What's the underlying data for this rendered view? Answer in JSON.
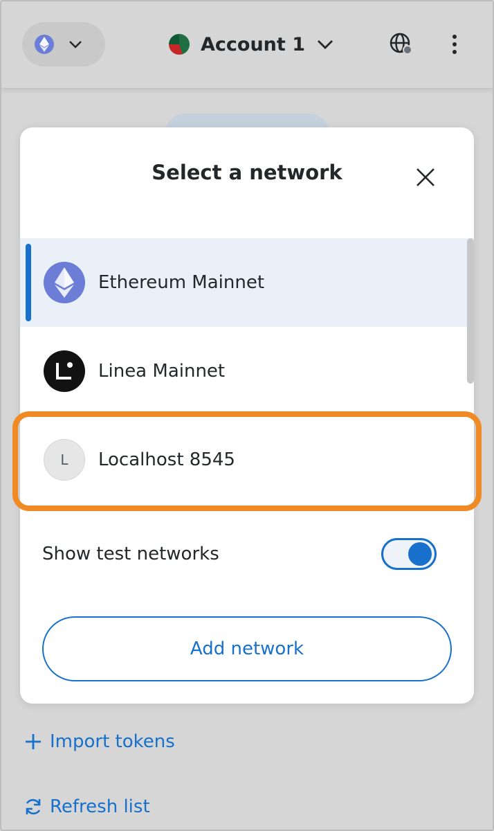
{
  "header": {
    "network_icon": "ethereum-icon",
    "account_name": "Account 1"
  },
  "modal": {
    "title": "Select a network",
    "networks": [
      {
        "name": "Ethereum Mainnet",
        "icon": "ethereum-icon",
        "selected": true
      },
      {
        "name": "Linea Mainnet",
        "icon": "linea-icon",
        "selected": false
      },
      {
        "name": "Localhost 8545",
        "icon_letter": "L",
        "selected": false
      }
    ],
    "show_test_networks_label": "Show test networks",
    "show_test_networks_on": true,
    "add_network_label": "Add network"
  },
  "footer": {
    "import_tokens_label": "Import tokens",
    "refresh_list_label": "Refresh list"
  },
  "colors": {
    "accent": "#1670cc",
    "highlight": "#f08a24",
    "ethereum": "#6b7dd6"
  }
}
